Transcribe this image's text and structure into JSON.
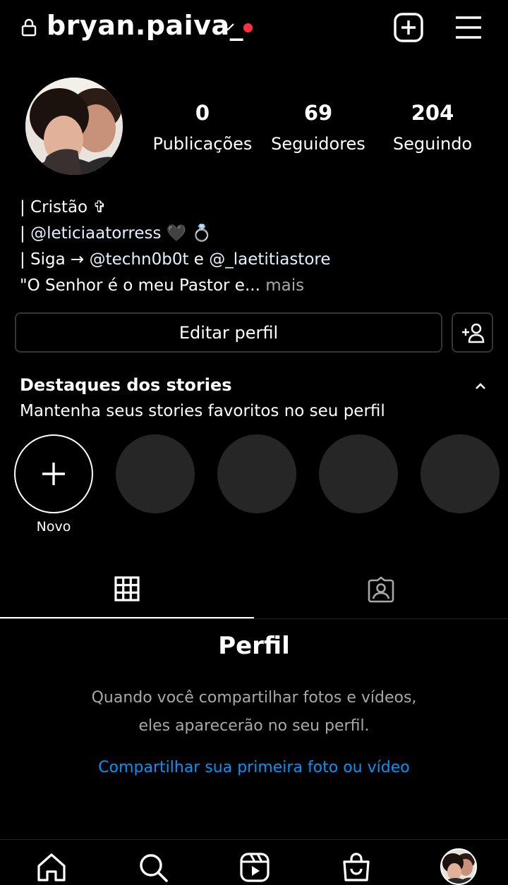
{
  "header": {
    "username": "bryan.paiva_"
  },
  "stats": [
    {
      "value": "0",
      "label": "Publicações"
    },
    {
      "value": "69",
      "label": "Seguidores"
    },
    {
      "value": "204",
      "label": "Seguindo"
    }
  ],
  "bio": {
    "line1_text": "| Cristão ✞",
    "line2_prefix": "| ",
    "line2_mention": "@leticiaatorress",
    "line2_emoji": " 🖤 💍",
    "line3_prefix": "| Siga → ",
    "line3_mention1": "@techn0b0t",
    "line3_mid": " e ",
    "line3_mention2": "@_laetitiastore",
    "line4_text": "\"O Senhor é o meu Pastor e... ",
    "line4_more": "mais"
  },
  "actions": {
    "edit_profile": "Editar perfil"
  },
  "highlights": {
    "title": "Destaques dos stories",
    "subtitle": "Mantenha seus stories favoritos no seu perfil",
    "new_label": "Novo"
  },
  "empty_state": {
    "title": "Perfil",
    "text": "Quando você compartilhar fotos e vídeos, eles aparecerão no seu perfil.",
    "link": "Compartilhar sua primeira foto ou vídeo"
  },
  "icons": {
    "lock": "lock-icon",
    "new_post": "plus-square-icon",
    "menu": "hamburger-menu-icon",
    "grid": "grid-icon",
    "tagged": "tagged-icon",
    "home": "home-icon",
    "search": "search-icon",
    "reels": "reels-icon",
    "shop": "shop-icon"
  },
  "colors": {
    "background": "#000000",
    "link": "#0095f6",
    "notification_dot": "#ff3040",
    "secondary_text": "#a8a8a8"
  }
}
